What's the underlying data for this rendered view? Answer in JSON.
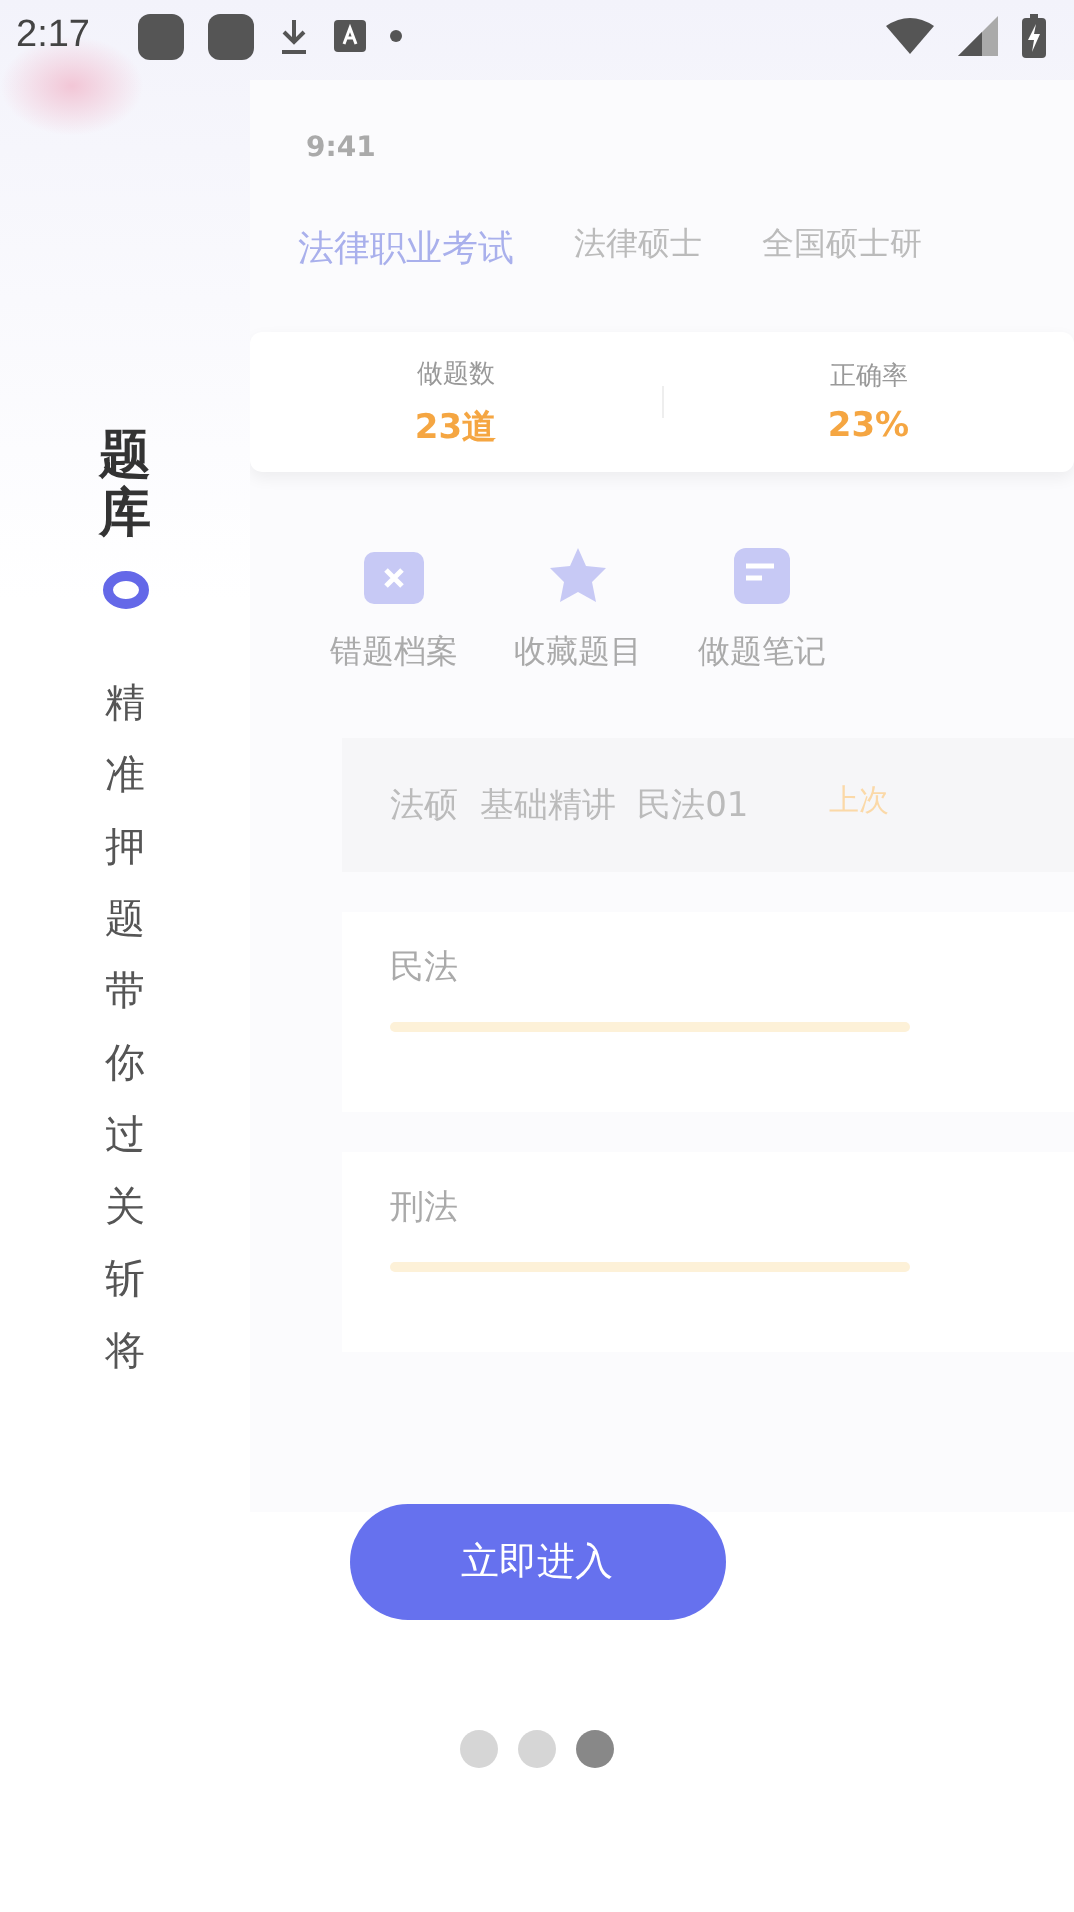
{
  "status_bar": {
    "time": "2:17"
  },
  "side": {
    "title": "题库",
    "slogan": "精准押题带你过关斩将"
  },
  "phone": {
    "time": "9:41",
    "tabs": [
      {
        "label": "法律职业考试",
        "selected": true
      },
      {
        "label": "法律硕士",
        "selected": false
      },
      {
        "label": "全国硕士研",
        "selected": false
      }
    ],
    "stats": [
      {
        "label": "做题数",
        "value": "23道"
      },
      {
        "label": "正确率",
        "value": "23%"
      }
    ],
    "shortcuts": [
      {
        "label": "错题档案",
        "kind": "mistakes"
      },
      {
        "label": "收藏题目",
        "kind": "favorites"
      },
      {
        "label": "做题笔记",
        "kind": "notes"
      }
    ],
    "course": {
      "title": "法硕  基础精讲  民法01",
      "hint": "上次"
    },
    "subjects": [
      {
        "name": "民法"
      },
      {
        "name": "刑法"
      }
    ]
  },
  "enter_button": "立即进入",
  "pager": [
    {
      "selected": false
    },
    {
      "selected": false
    },
    {
      "selected": true
    }
  ]
}
